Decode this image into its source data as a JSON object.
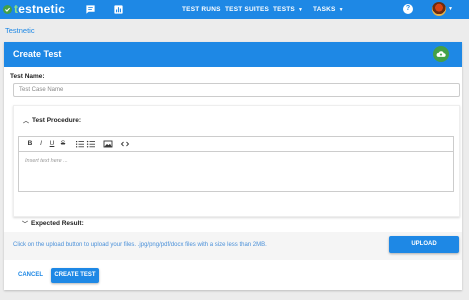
{
  "app": {
    "logo_prefix": "t",
    "logo_rest": "estnetic"
  },
  "nav": {
    "test_runs": "TEST RUNS",
    "test_suites": "TEST SUITES",
    "tests": "TESTS",
    "tasks": "TASKS",
    "help": "?"
  },
  "breadcrumb": "Testnetic",
  "form": {
    "title": "Create Test",
    "test_name_label": "Test Name:",
    "test_name_placeholder": "Test Case Name",
    "test_procedure_label": "Test Procedure:",
    "editor_placeholder": "Insert text here ...",
    "expected_result_label": "Expected Result:",
    "toolbar": {
      "bold": "B",
      "italic": "I",
      "underline": "U",
      "strike": "S"
    }
  },
  "upload": {
    "hint": "Click on the upload button to upload your files. .jpg/png/pdf/docx files with a size less than 2MB.",
    "button": "UPLOAD"
  },
  "actions": {
    "cancel": "CANCEL",
    "create": "CREATE TEST"
  },
  "colors": {
    "primary": "#1e88e5",
    "success": "#43a047"
  },
  "icons": [
    "check-logo-icon",
    "chat-icon",
    "chart-icon",
    "help-icon",
    "cloud-upload-icon",
    "chevron-up-icon",
    "chevron-down-icon",
    "image-icon",
    "code-icon",
    "ordered-list-icon",
    "bullet-list-icon"
  ]
}
